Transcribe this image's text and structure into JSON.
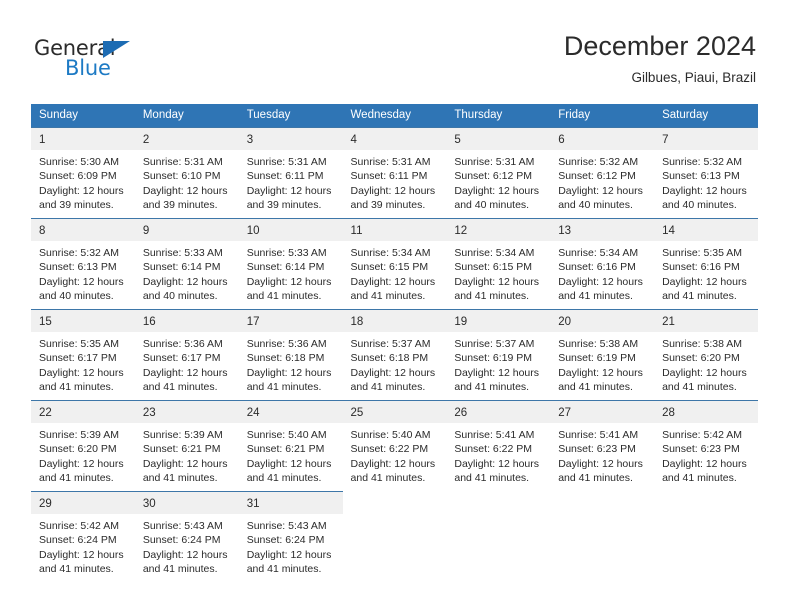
{
  "brand": {
    "word_one": "General",
    "word_two": "Blue",
    "flag_icon": "triangle-flag-icon"
  },
  "header": {
    "title": "December 2024",
    "subtitle": "Gilbues, Piaui, Brazil"
  },
  "colors": {
    "header_blue": "#2f75b5",
    "brand_blue": "#1d7ac4",
    "daynum_band": "#f0f0f0",
    "cell_border": "#3d76a8",
    "text": "#2b2b2b"
  },
  "labels": {
    "sunrise_prefix": "Sunrise:",
    "sunset_prefix": "Sunset:",
    "daylight_prefix": "Daylight:"
  },
  "weekdays": [
    "Sunday",
    "Monday",
    "Tuesday",
    "Wednesday",
    "Thursday",
    "Friday",
    "Saturday"
  ],
  "weeks": [
    [
      {
        "day": "1",
        "sunrise": "Sunrise: 5:30 AM",
        "sunset": "Sunset: 6:09 PM",
        "daylight_a": "Daylight: 12 hours",
        "daylight_b": "and 39 minutes."
      },
      {
        "day": "2",
        "sunrise": "Sunrise: 5:31 AM",
        "sunset": "Sunset: 6:10 PM",
        "daylight_a": "Daylight: 12 hours",
        "daylight_b": "and 39 minutes."
      },
      {
        "day": "3",
        "sunrise": "Sunrise: 5:31 AM",
        "sunset": "Sunset: 6:11 PM",
        "daylight_a": "Daylight: 12 hours",
        "daylight_b": "and 39 minutes."
      },
      {
        "day": "4",
        "sunrise": "Sunrise: 5:31 AM",
        "sunset": "Sunset: 6:11 PM",
        "daylight_a": "Daylight: 12 hours",
        "daylight_b": "and 39 minutes."
      },
      {
        "day": "5",
        "sunrise": "Sunrise: 5:31 AM",
        "sunset": "Sunset: 6:12 PM",
        "daylight_a": "Daylight: 12 hours",
        "daylight_b": "and 40 minutes."
      },
      {
        "day": "6",
        "sunrise": "Sunrise: 5:32 AM",
        "sunset": "Sunset: 6:12 PM",
        "daylight_a": "Daylight: 12 hours",
        "daylight_b": "and 40 minutes."
      },
      {
        "day": "7",
        "sunrise": "Sunrise: 5:32 AM",
        "sunset": "Sunset: 6:13 PM",
        "daylight_a": "Daylight: 12 hours",
        "daylight_b": "and 40 minutes."
      }
    ],
    [
      {
        "day": "8",
        "sunrise": "Sunrise: 5:32 AM",
        "sunset": "Sunset: 6:13 PM",
        "daylight_a": "Daylight: 12 hours",
        "daylight_b": "and 40 minutes."
      },
      {
        "day": "9",
        "sunrise": "Sunrise: 5:33 AM",
        "sunset": "Sunset: 6:14 PM",
        "daylight_a": "Daylight: 12 hours",
        "daylight_b": "and 40 minutes."
      },
      {
        "day": "10",
        "sunrise": "Sunrise: 5:33 AM",
        "sunset": "Sunset: 6:14 PM",
        "daylight_a": "Daylight: 12 hours",
        "daylight_b": "and 41 minutes."
      },
      {
        "day": "11",
        "sunrise": "Sunrise: 5:34 AM",
        "sunset": "Sunset: 6:15 PM",
        "daylight_a": "Daylight: 12 hours",
        "daylight_b": "and 41 minutes."
      },
      {
        "day": "12",
        "sunrise": "Sunrise: 5:34 AM",
        "sunset": "Sunset: 6:15 PM",
        "daylight_a": "Daylight: 12 hours",
        "daylight_b": "and 41 minutes."
      },
      {
        "day": "13",
        "sunrise": "Sunrise: 5:34 AM",
        "sunset": "Sunset: 6:16 PM",
        "daylight_a": "Daylight: 12 hours",
        "daylight_b": "and 41 minutes."
      },
      {
        "day": "14",
        "sunrise": "Sunrise: 5:35 AM",
        "sunset": "Sunset: 6:16 PM",
        "daylight_a": "Daylight: 12 hours",
        "daylight_b": "and 41 minutes."
      }
    ],
    [
      {
        "day": "15",
        "sunrise": "Sunrise: 5:35 AM",
        "sunset": "Sunset: 6:17 PM",
        "daylight_a": "Daylight: 12 hours",
        "daylight_b": "and 41 minutes."
      },
      {
        "day": "16",
        "sunrise": "Sunrise: 5:36 AM",
        "sunset": "Sunset: 6:17 PM",
        "daylight_a": "Daylight: 12 hours",
        "daylight_b": "and 41 minutes."
      },
      {
        "day": "17",
        "sunrise": "Sunrise: 5:36 AM",
        "sunset": "Sunset: 6:18 PM",
        "daylight_a": "Daylight: 12 hours",
        "daylight_b": "and 41 minutes."
      },
      {
        "day": "18",
        "sunrise": "Sunrise: 5:37 AM",
        "sunset": "Sunset: 6:18 PM",
        "daylight_a": "Daylight: 12 hours",
        "daylight_b": "and 41 minutes."
      },
      {
        "day": "19",
        "sunrise": "Sunrise: 5:37 AM",
        "sunset": "Sunset: 6:19 PM",
        "daylight_a": "Daylight: 12 hours",
        "daylight_b": "and 41 minutes."
      },
      {
        "day": "20",
        "sunrise": "Sunrise: 5:38 AM",
        "sunset": "Sunset: 6:19 PM",
        "daylight_a": "Daylight: 12 hours",
        "daylight_b": "and 41 minutes."
      },
      {
        "day": "21",
        "sunrise": "Sunrise: 5:38 AM",
        "sunset": "Sunset: 6:20 PM",
        "daylight_a": "Daylight: 12 hours",
        "daylight_b": "and 41 minutes."
      }
    ],
    [
      {
        "day": "22",
        "sunrise": "Sunrise: 5:39 AM",
        "sunset": "Sunset: 6:20 PM",
        "daylight_a": "Daylight: 12 hours",
        "daylight_b": "and 41 minutes."
      },
      {
        "day": "23",
        "sunrise": "Sunrise: 5:39 AM",
        "sunset": "Sunset: 6:21 PM",
        "daylight_a": "Daylight: 12 hours",
        "daylight_b": "and 41 minutes."
      },
      {
        "day": "24",
        "sunrise": "Sunrise: 5:40 AM",
        "sunset": "Sunset: 6:21 PM",
        "daylight_a": "Daylight: 12 hours",
        "daylight_b": "and 41 minutes."
      },
      {
        "day": "25",
        "sunrise": "Sunrise: 5:40 AM",
        "sunset": "Sunset: 6:22 PM",
        "daylight_a": "Daylight: 12 hours",
        "daylight_b": "and 41 minutes."
      },
      {
        "day": "26",
        "sunrise": "Sunrise: 5:41 AM",
        "sunset": "Sunset: 6:22 PM",
        "daylight_a": "Daylight: 12 hours",
        "daylight_b": "and 41 minutes."
      },
      {
        "day": "27",
        "sunrise": "Sunrise: 5:41 AM",
        "sunset": "Sunset: 6:23 PM",
        "daylight_a": "Daylight: 12 hours",
        "daylight_b": "and 41 minutes."
      },
      {
        "day": "28",
        "sunrise": "Sunrise: 5:42 AM",
        "sunset": "Sunset: 6:23 PM",
        "daylight_a": "Daylight: 12 hours",
        "daylight_b": "and 41 minutes."
      }
    ],
    [
      {
        "day": "29",
        "sunrise": "Sunrise: 5:42 AM",
        "sunset": "Sunset: 6:24 PM",
        "daylight_a": "Daylight: 12 hours",
        "daylight_b": "and 41 minutes."
      },
      {
        "day": "30",
        "sunrise": "Sunrise: 5:43 AM",
        "sunset": "Sunset: 6:24 PM",
        "daylight_a": "Daylight: 12 hours",
        "daylight_b": "and 41 minutes."
      },
      {
        "day": "31",
        "sunrise": "Sunrise: 5:43 AM",
        "sunset": "Sunset: 6:24 PM",
        "daylight_a": "Daylight: 12 hours",
        "daylight_b": "and 41 minutes."
      },
      null,
      null,
      null,
      null
    ]
  ]
}
